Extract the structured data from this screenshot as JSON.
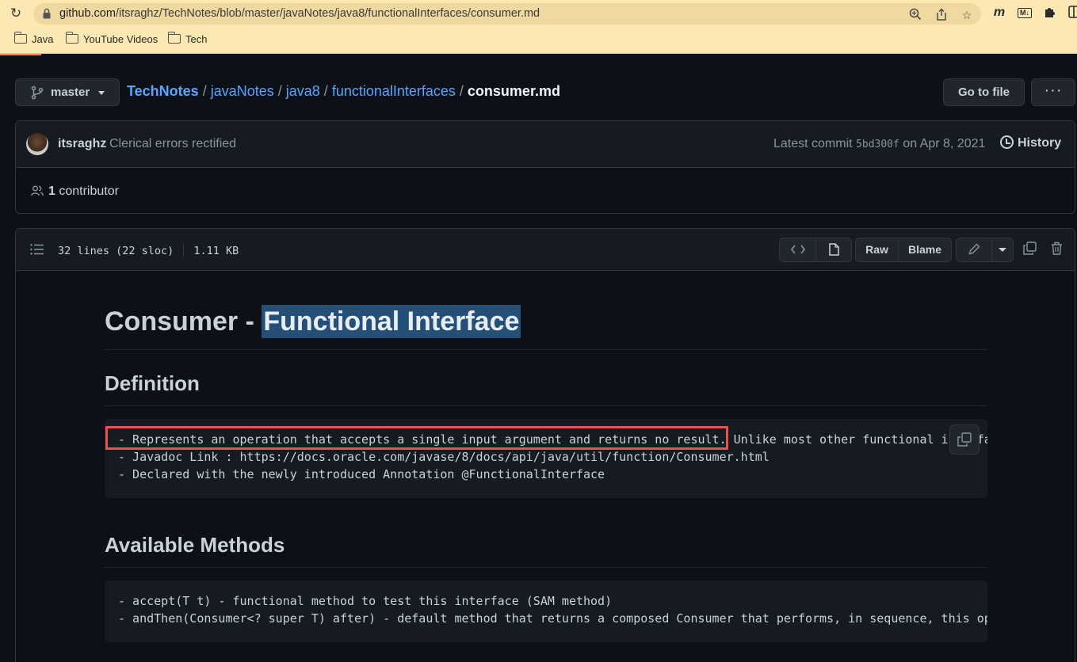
{
  "browser": {
    "url_host": "github.com",
    "url_path": "/itsraghz/TechNotes/blob/master/javaNotes/java8/functionalInterfaces/consumer.md",
    "bookmarks": [
      {
        "label": "Java"
      },
      {
        "label": "YouTube Videos"
      },
      {
        "label": "Tech"
      }
    ],
    "extensions": [
      {
        "name": "m-icon",
        "glyph": "m"
      },
      {
        "name": "markdown-icon",
        "glyph": "M↓"
      }
    ]
  },
  "repo": {
    "branch": "master",
    "breadcrumb": [
      "TechNotes",
      "javaNotes",
      "java8",
      "functionalInterfaces"
    ],
    "filename": "consumer.md",
    "goto_label": "Go to file",
    "more_label": "···"
  },
  "commit": {
    "author": "itsraghz",
    "message": "Clerical errors rectified",
    "latest_prefix": "Latest commit",
    "sha": "5bd300f",
    "date": "on Apr 8, 2021",
    "history_label": "History",
    "contributors_count": "1",
    "contributors_label": "contributor"
  },
  "file": {
    "lines": "32 lines (22 sloc)",
    "size": "1.11 KB",
    "raw_label": "Raw",
    "blame_label": "Blame"
  },
  "content": {
    "title_plain": "Consumer - ",
    "title_selected": "Functional Interface",
    "definition_heading": "Definition",
    "definition_lines": [
      "- Represents an operation that accepts a single input argument and returns no result. Unlike most other functional interfa",
      "- Javadoc Link : https://docs.oracle.com/javase/8/docs/api/java/util/function/Consumer.html",
      "- Declared with the newly introduced Annotation @FunctionalInterface"
    ],
    "methods_heading": "Available Methods",
    "methods_lines": [
      "- accept(T t) - functional method to test this interface (SAM method)",
      "- andThen(Consumer<? super T) after) - default method that returns a composed Consumer that performs, in sequence, this op"
    ]
  },
  "colors": {
    "background": "#0d1117",
    "link": "#58a6ff",
    "highlight_box": "#e5534b",
    "selection": "#264f78",
    "browser_toolbar": "#fce8b2"
  }
}
